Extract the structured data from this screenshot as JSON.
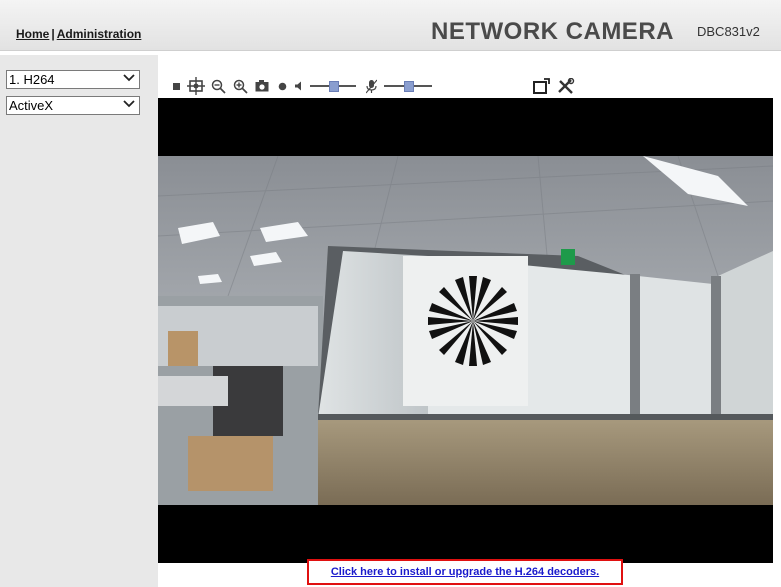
{
  "header": {
    "nav_home": "Home",
    "nav_separator": "|",
    "nav_admin": "Administration",
    "brand": "NETWORK CAMERA",
    "model": "DBC831v2"
  },
  "controls": {
    "stream_select": {
      "value": "1. H264",
      "options": [
        "1. H264"
      ]
    },
    "plugin_select": {
      "value": "ActiveX",
      "options": [
        "ActiveX"
      ]
    }
  },
  "toolbar": {
    "icons": [
      "stop-icon",
      "digital-zoom-icon",
      "zoom-out-icon",
      "zoom-in-icon",
      "snapshot-icon",
      "record-icon",
      "speaker-icon",
      "microphone-icon",
      "popout-icon",
      "settings-icon"
    ],
    "speaker_volume_level": 0.5,
    "microphone_volume_level": 0.5
  },
  "install_link": "Click here to install or upgrade the H.264 decoders.",
  "colors": {
    "highlight_border": "#e01010",
    "link": "#1a1acc",
    "slider_knob": "#8a9ecf"
  }
}
